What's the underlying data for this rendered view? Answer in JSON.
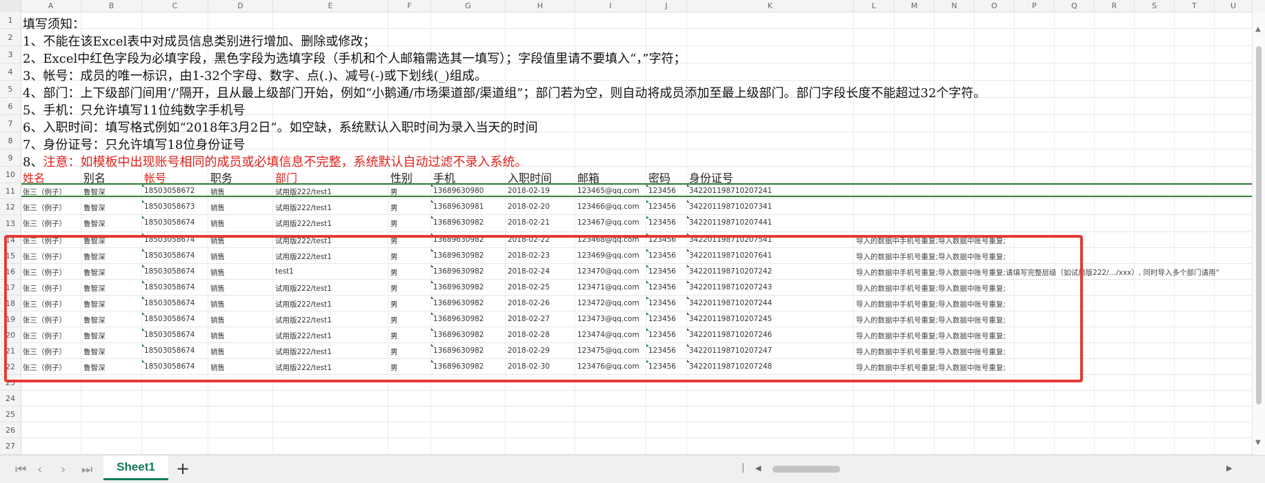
{
  "column_headers": [
    "A",
    "B",
    "C",
    "D",
    "E",
    "F",
    "G",
    "H",
    "I",
    "J",
    "K",
    "L",
    "M",
    "N",
    "O",
    "P",
    "Q",
    "R",
    "S",
    "T",
    "U"
  ],
  "row_numbers": [
    "1",
    "2",
    "3",
    "4",
    "5",
    "6",
    "7",
    "8",
    "9",
    "10",
    "11",
    "12",
    "13",
    "14",
    "15",
    "16",
    "17",
    "18",
    "19",
    "20",
    "21",
    "22",
    "23",
    "24",
    "25",
    "26",
    "27"
  ],
  "notes": {
    "title": "填写须知：",
    "n1": "1、不能在该Excel表中对成员信息类别进行增加、删除或修改；",
    "n2": "2、Excel中红色字段为必填字段，黑色字段为选填字段（手机和个人邮箱需选其一填写）；字段值里请不要填入“，”字符；",
    "n3": "3、帐号：成员的唯一标识，由1-32个字母、数字、点(.)、减号(-)或下划线(_)组成。",
    "n4": "4、部门：上下级部门间用‘/’隔开，且从最上级部门开始，例如“小鹅通/市场渠道部/渠道组”；部门若为空，则自动将成员添加至最上级部门。部门字段长度不能超过32个字符。",
    "n5": "5、手机：只允许填写11位纯数字手机号",
    "n6": "6、入职时间：填写格式例如“2018年3月2日”。如空缺，系统默认入职时间为录入当天的时间",
    "n7": "7、身份证号：只允许填写18位身份证号",
    "n8_prefix": "8、",
    "n8_warning": "注意：如模板中出现账号相同的成员或必填信息不完整，系统默认自动过滤不录入系统。"
  },
  "table": {
    "headers": [
      {
        "label": "姓名",
        "color": "#e0201a"
      },
      {
        "label": "别名",
        "color": "#222222"
      },
      {
        "label": "帐号",
        "color": "#e0201a"
      },
      {
        "label": "职务",
        "color": "#222222"
      },
      {
        "label": "部门",
        "color": "#e0201a"
      },
      {
        "label": "性别",
        "color": "#222222"
      },
      {
        "label": "手机",
        "color": "#222222"
      },
      {
        "label": "入职时间",
        "color": "#222222"
      },
      {
        "label": "邮箱",
        "color": "#222222"
      },
      {
        "label": "密码",
        "color": "#222222"
      },
      {
        "label": "身份证号",
        "color": "#222222"
      }
    ],
    "rows": [
      {
        "row": "11",
        "cells": [
          "张三（例子）",
          "鲁智深",
          "18503058672",
          "销售",
          "试用版222/test1",
          "男",
          "13689630980",
          "2018-02-19",
          "123465@qq.com",
          "123456",
          "342201198710207241"
        ],
        "error": ""
      },
      {
        "row": "12",
        "cells": [
          "张三（例子）",
          "鲁智深",
          "18503058673",
          "销售",
          "试用版222/test1",
          "男",
          "13689630981",
          "2018-02-20",
          "123466@qq.com",
          "123456",
          "342201198710207341"
        ],
        "error": ""
      },
      {
        "row": "13",
        "cells": [
          "张三（例子）",
          "鲁智深",
          "18503058674",
          "销售",
          "试用版222/test1",
          "男",
          "13689630982",
          "2018-02-21",
          "123467@qq.com",
          "123456",
          "342201198710207441"
        ],
        "error": ""
      },
      {
        "row": "14",
        "cells": [
          "张三（例子）",
          "鲁智深",
          "18503058674",
          "销售",
          "试用版222/test1",
          "男",
          "13689630982",
          "2018-02-22",
          "123468@qq.com",
          "123456",
          "342201198710207541"
        ],
        "error": "导入的数据中手机号重复;导入数据中账号重复;"
      },
      {
        "row": "15",
        "cells": [
          "张三（例子）",
          "鲁智深",
          "18503058674",
          "销售",
          "试用版222/test1",
          "男",
          "13689630982",
          "2018-02-23",
          "123469@qq.com",
          "123456",
          "342201198710207641"
        ],
        "error": "导入的数据中手机号重复;导入数据中账号重复;"
      },
      {
        "row": "16",
        "cells": [
          "张三（例子）",
          "鲁智深",
          "18503058674",
          "销售",
          "test1",
          "男",
          "13689630982",
          "2018-02-24",
          "123470@qq.com",
          "123456",
          "342201198710207242"
        ],
        "error": "导入的数据中手机号重复;导入数据中账号重复;请填写完整层级（如试用版222/…/xxx）, 同时导入多个部门请用“"
      },
      {
        "row": "17",
        "cells": [
          "张三（例子）",
          "鲁智深",
          "18503058674",
          "销售",
          "试用版222/test1",
          "男",
          "13689630982",
          "2018-02-25",
          "123471@qq.com",
          "123456",
          "342201198710207243"
        ],
        "error": "导入的数据中手机号重复;导入数据中账号重复;"
      },
      {
        "row": "18",
        "cells": [
          "张三（例子）",
          "鲁智深",
          "18503058674",
          "销售",
          "试用版222/test1",
          "男",
          "13689630982",
          "2018-02-26",
          "123472@qq.com",
          "123456",
          "342201198710207244"
        ],
        "error": "导入的数据中手机号重复;导入数据中账号重复;"
      },
      {
        "row": "19",
        "cells": [
          "张三（例子）",
          "鲁智深",
          "18503058674",
          "销售",
          "试用版222/test1",
          "男",
          "13689630982",
          "2018-02-27",
          "123473@qq.com",
          "123456",
          "342201198710207245"
        ],
        "error": "导入的数据中手机号重复;导入数据中账号重复;"
      },
      {
        "row": "20",
        "cells": [
          "张三（例子）",
          "鲁智深",
          "18503058674",
          "销售",
          "试用版222/test1",
          "男",
          "13689630982",
          "2018-02-28",
          "123474@qq.com",
          "123456",
          "342201198710207246"
        ],
        "error": "导入的数据中手机号重复;导入数据中账号重复;"
      },
      {
        "row": "21",
        "cells": [
          "张三（例子）",
          "鲁智深",
          "18503058674",
          "销售",
          "试用版222/test1",
          "男",
          "13689630982",
          "2018-02-29",
          "123475@qq.com",
          "123456",
          "342201198710207247"
        ],
        "error": "导入的数据中手机号重复;导入数据中账号重复;"
      },
      {
        "row": "22",
        "cells": [
          "张三（例子）",
          "鲁智深",
          "18503058674",
          "销售",
          "试用版222/test1",
          "男",
          "13689630982",
          "2018-02-30",
          "123476@qq.com",
          "123456",
          "342201198710207248"
        ],
        "error": "导入的数据中手机号重复;导入数据中账号重复;"
      }
    ]
  },
  "sheet_tabs": {
    "active": "Sheet1",
    "add": "+"
  },
  "nav_icons": {
    "first": "first-sheet-icon",
    "prev": "prev-sheet-icon",
    "next": "next-sheet-icon",
    "last": "last-sheet-icon"
  },
  "colors": {
    "accent_green": "#0f7b5a",
    "selection_green": "#2e7d32",
    "highlight_red": "#e53935",
    "required_red": "#e0201a"
  }
}
